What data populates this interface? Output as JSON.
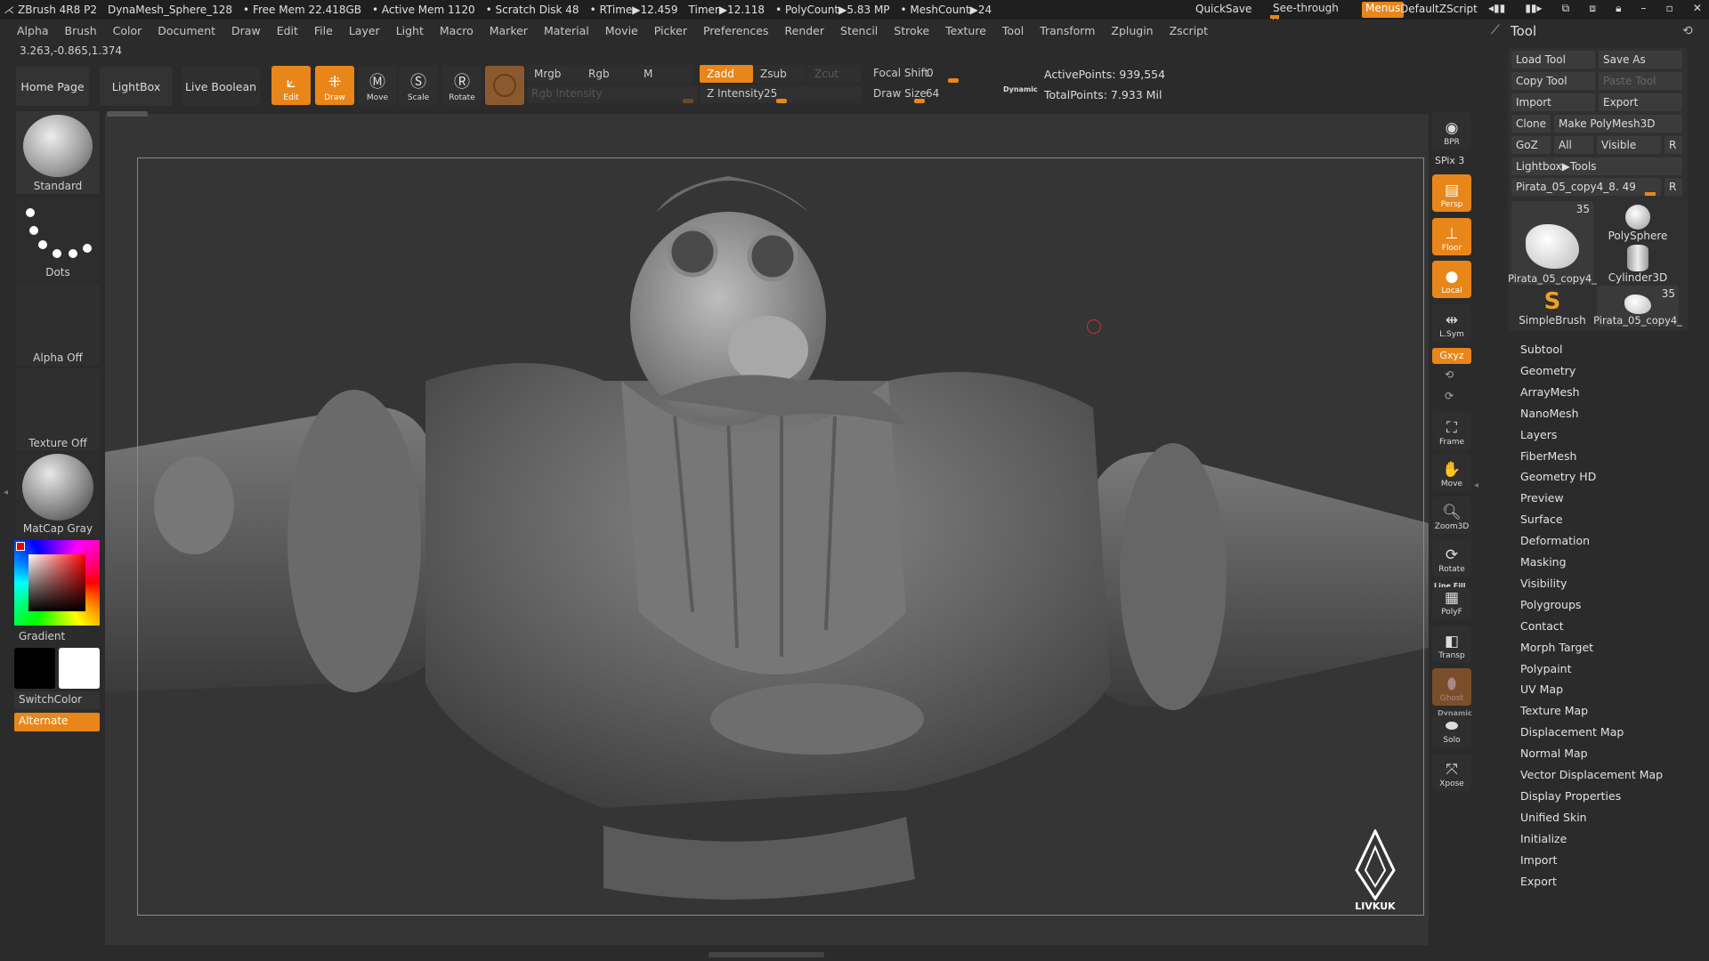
{
  "titlebar": {
    "app": "ZBrush 4R8 P2",
    "document": "DynaMesh_Sphere_128",
    "free_mem": "• Free Mem 22.418GB",
    "active_mem": "• Active Mem 1120",
    "scratch_disk": "• Scratch Disk 48",
    "rtime": "• RTime▶12.459",
    "timer": "Timer▶12.118",
    "polycount": "• PolyCount▶5.83 MP",
    "meshcount": "• MeshCount▶24",
    "quicksave": "QuickSave",
    "seethrough_label": "See-through",
    "seethrough_value": "0",
    "menus": "Menus",
    "default_zscript": "DefaultZScript"
  },
  "menubar": [
    "Alpha",
    "Brush",
    "Color",
    "Document",
    "Draw",
    "Edit",
    "File",
    "Layer",
    "Light",
    "Macro",
    "Marker",
    "Material",
    "Movie",
    "Picker",
    "Preferences",
    "Render",
    "Stencil",
    "Stroke",
    "Texture",
    "Tool",
    "Transform",
    "Zplugin",
    "Zscript"
  ],
  "coords": "3.263,-0.865,1.374",
  "shelf": {
    "home_page": "Home Page",
    "lightbox": "LightBox",
    "live_boolean": "Live Boolean",
    "edit": "Edit",
    "draw": "Draw",
    "move": "Move",
    "scale": "Scale",
    "rotate": "Rotate",
    "mrgb": "Mrgb",
    "rgb": "Rgb",
    "m": "M",
    "rgb_intensity": "Rgb Intensity",
    "zadd": "Zadd",
    "zsub": "Zsub",
    "zcut": "Zcut",
    "z_intensity_label": "Z Intensity",
    "z_intensity_value": "25",
    "focal_shift_label": "Focal Shift",
    "focal_shift_value": "0",
    "draw_size_label": "Draw Size",
    "draw_size_value": "64",
    "dynamic": "Dynamic",
    "active_points": "ActivePoints: 939,554",
    "total_points": "TotalPoints: 7.933 Mil"
  },
  "left_palette": {
    "brush": "Standard",
    "stroke": "Dots",
    "alpha": "Alpha Off",
    "texture": "Texture Off",
    "material": "MatCap Gray",
    "gradient": "Gradient",
    "switchcolor": "SwitchColor",
    "alternate": "Alternate"
  },
  "right_shelf": {
    "bpr": "BPR",
    "spix": "SPix 3",
    "persp": "Persp",
    "floor": "Floor",
    "local": "Local",
    "lsym": "L.Sym",
    "xyz": "Gxyz",
    "frame": "Frame",
    "move": "Move",
    "zoom3d": "Zoom3D",
    "rotate": "Rotate",
    "linefill": "Line Fill",
    "polyf": "PolyF",
    "transp": "Transp",
    "ghost": "Ghost",
    "dynamic_solo": "Dynamic",
    "solo": "Solo",
    "xpose": "Xpose"
  },
  "tool_panel": {
    "title": "Tool",
    "load_tool": "Load Tool",
    "save_as": "Save As",
    "copy_tool": "Copy Tool",
    "paste_tool": "Paste Tool",
    "import": "Import",
    "export": "Export",
    "clone": "Clone",
    "make_polymesh": "Make PolyMesh3D",
    "goz": "GoZ",
    "all": "All",
    "visible": "Visible",
    "r": "R",
    "lightbox_tools": "Lightbox▶Tools",
    "current_tool": "Pirata_05_copy4_8.",
    "current_tool_value": "49",
    "thumbs": [
      {
        "label": "Pirata_05_copy4_",
        "badge": "35"
      },
      {
        "label": "PolySphere",
        "badge": ""
      },
      {
        "label": "Cylinder3D",
        "badge": ""
      },
      {
        "label": "SimpleBrush",
        "badge": ""
      },
      {
        "label": "Pirata_05_copy4_",
        "badge": "35"
      }
    ],
    "subpalettes": [
      "Subtool",
      "Geometry",
      "ArrayMesh",
      "NanoMesh",
      "Layers",
      "FiberMesh",
      "Geometry HD",
      "Preview",
      "Surface",
      "Deformation",
      "Masking",
      "Visibility",
      "Polygroups",
      "Contact",
      "Morph Target",
      "Polypaint",
      "UV Map",
      "Texture Map",
      "Displacement Map",
      "Normal Map",
      "Vector Displacement Map",
      "Display Properties",
      "Unified Skin",
      "Initialize",
      "Import",
      "Export"
    ]
  },
  "watermark": "LIVKUK",
  "colors": {
    "accent": "#e8861a",
    "bg": "#2b2b2b",
    "canvas": "#353535"
  }
}
